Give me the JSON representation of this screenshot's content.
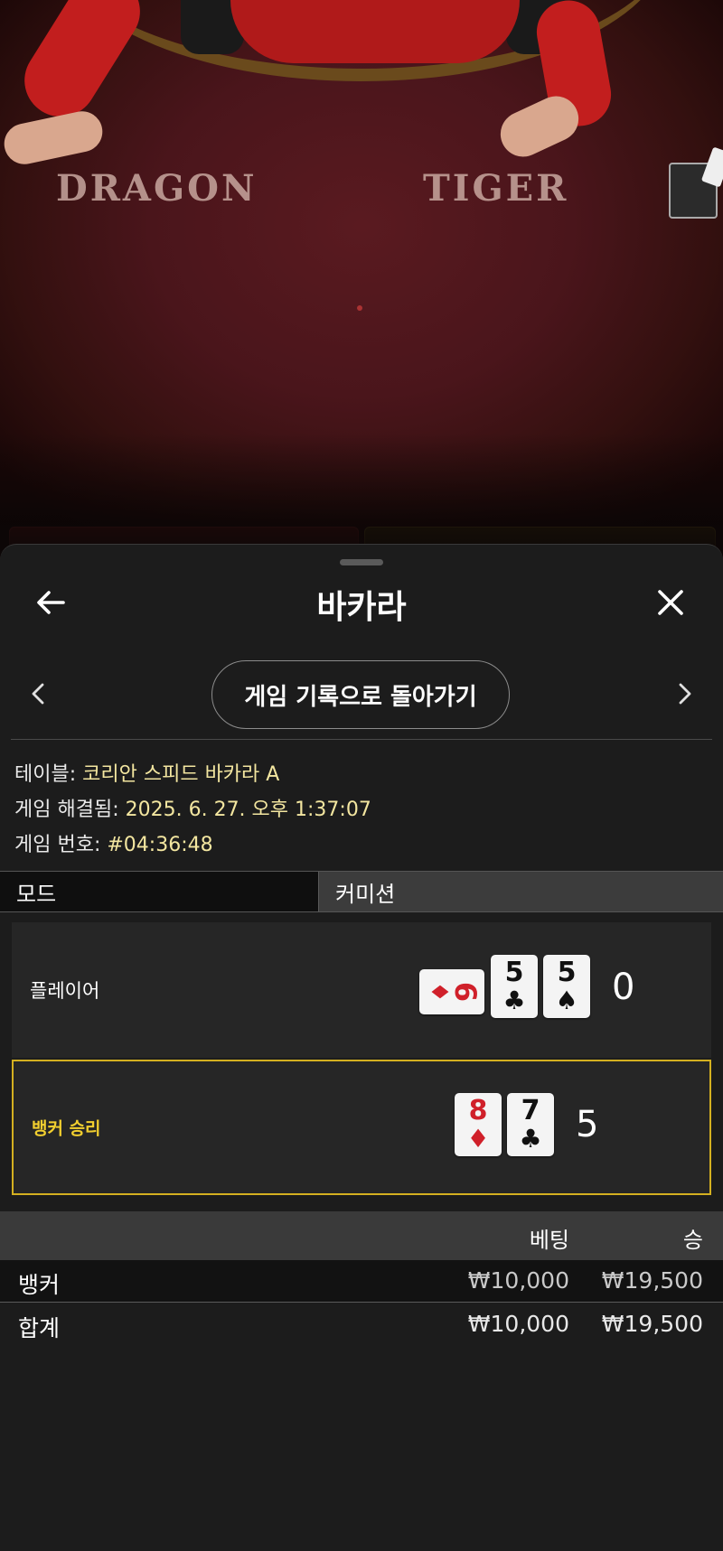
{
  "video": {
    "dragon_label": "DRAGON",
    "tiger_label": "TIGER"
  },
  "header": {
    "title": "바카라",
    "back_icon": "arrow-left-icon",
    "close_icon": "close-icon"
  },
  "nav": {
    "back_to_history_label": "게임 기록으로 돌아가기",
    "prev_icon": "chevron-left-icon",
    "next_icon": "chevron-right-icon"
  },
  "info": {
    "table_label": "테이블:",
    "table_value": "코리안 스피드 바카라 A",
    "resolved_label": "게임 해결됨:",
    "resolved_value": "2025. 6. 27. 오후 1:37:07",
    "game_no_label": "게임 번호:",
    "game_no_value": "#04:36:48"
  },
  "tabs": {
    "mode_label": "모드",
    "commission_label": "커미션"
  },
  "player": {
    "label": "플레이어",
    "score": "0",
    "cards": [
      {
        "rank": "6",
        "suit": "♦",
        "color": "red",
        "sideways": true
      },
      {
        "rank": "5",
        "suit": "♣",
        "color": "black"
      },
      {
        "rank": "5",
        "suit": "♠",
        "color": "black"
      }
    ]
  },
  "banker": {
    "label": "뱅커 승리",
    "score": "5",
    "highlight_color": "#d4b020",
    "cards": [
      {
        "rank": "8",
        "suit": "♦",
        "color": "red"
      },
      {
        "rank": "7",
        "suit": "♣",
        "color": "black"
      }
    ]
  },
  "bets": {
    "col_bet": "베팅",
    "col_win": "승",
    "rows": [
      {
        "name": "뱅커",
        "bet": "₩10,000",
        "win": "₩19,500"
      }
    ],
    "total": {
      "name": "합계",
      "bet": "₩10,000",
      "win": "₩19,500"
    }
  }
}
